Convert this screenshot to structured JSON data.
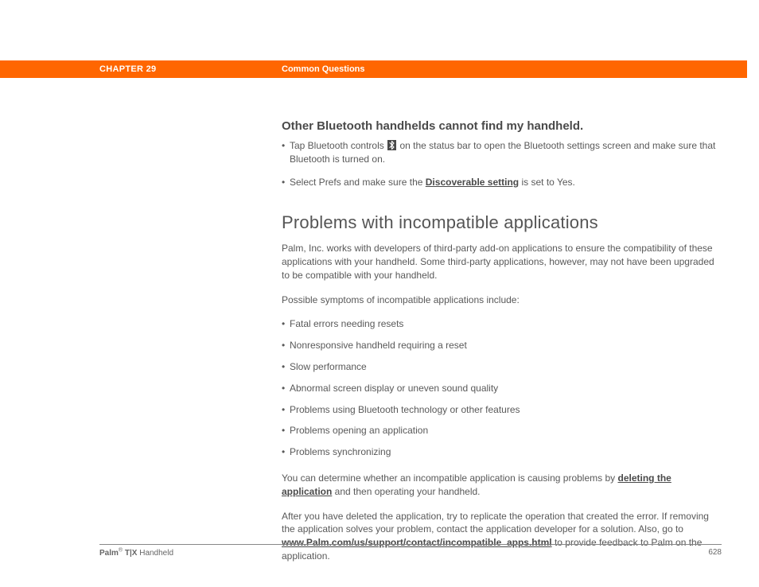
{
  "header": {
    "chapter": "CHAPTER 29",
    "section": "Common Questions"
  },
  "section1": {
    "heading": "Other Bluetooth handhelds cannot find my handheld.",
    "bullet1a": "Tap Bluetooth controls",
    "bullet1b": "on the status bar to open the Bluetooth settings screen and make sure that Bluetooth is turned on.",
    "bullet2a": "Select Prefs and make sure the ",
    "bullet2link": "Discoverable setting",
    "bullet2b": " is set to Yes."
  },
  "section2": {
    "heading": "Problems with incompatible applications",
    "intro": "Palm, Inc. works with developers of third-party add-on applications to ensure the compatibility of these applications with your handheld. Some third-party applications, however, may not have been upgraded to be compatible with your handheld.",
    "symptoms_intro": "Possible symptoms of incompatible applications include:",
    "symptoms": [
      "Fatal errors needing resets",
      "Nonresponsive handheld requiring a reset",
      "Slow performance",
      "Abnormal screen display or uneven sound quality",
      "Problems using Bluetooth technology or other features",
      "Problems opening an application",
      "Problems synchronizing"
    ],
    "determine_a": "You can determine whether an incompatible application is causing problems by ",
    "determine_link": "deleting the application",
    "determine_b": " and then operating your handheld.",
    "after_a": "After you have deleted the application, try to replicate the operation that created the error. If removing the application solves your problem, contact the application developer for a solution. Also, go to ",
    "after_link": "www.Palm.com/us/support/contact/incompatible_apps.html",
    "after_b": " to provide feedback to Palm on the application."
  },
  "footer": {
    "brand": "Palm",
    "reg": "®",
    "model": " T|X",
    "suffix": " Handheld",
    "page": "628"
  }
}
